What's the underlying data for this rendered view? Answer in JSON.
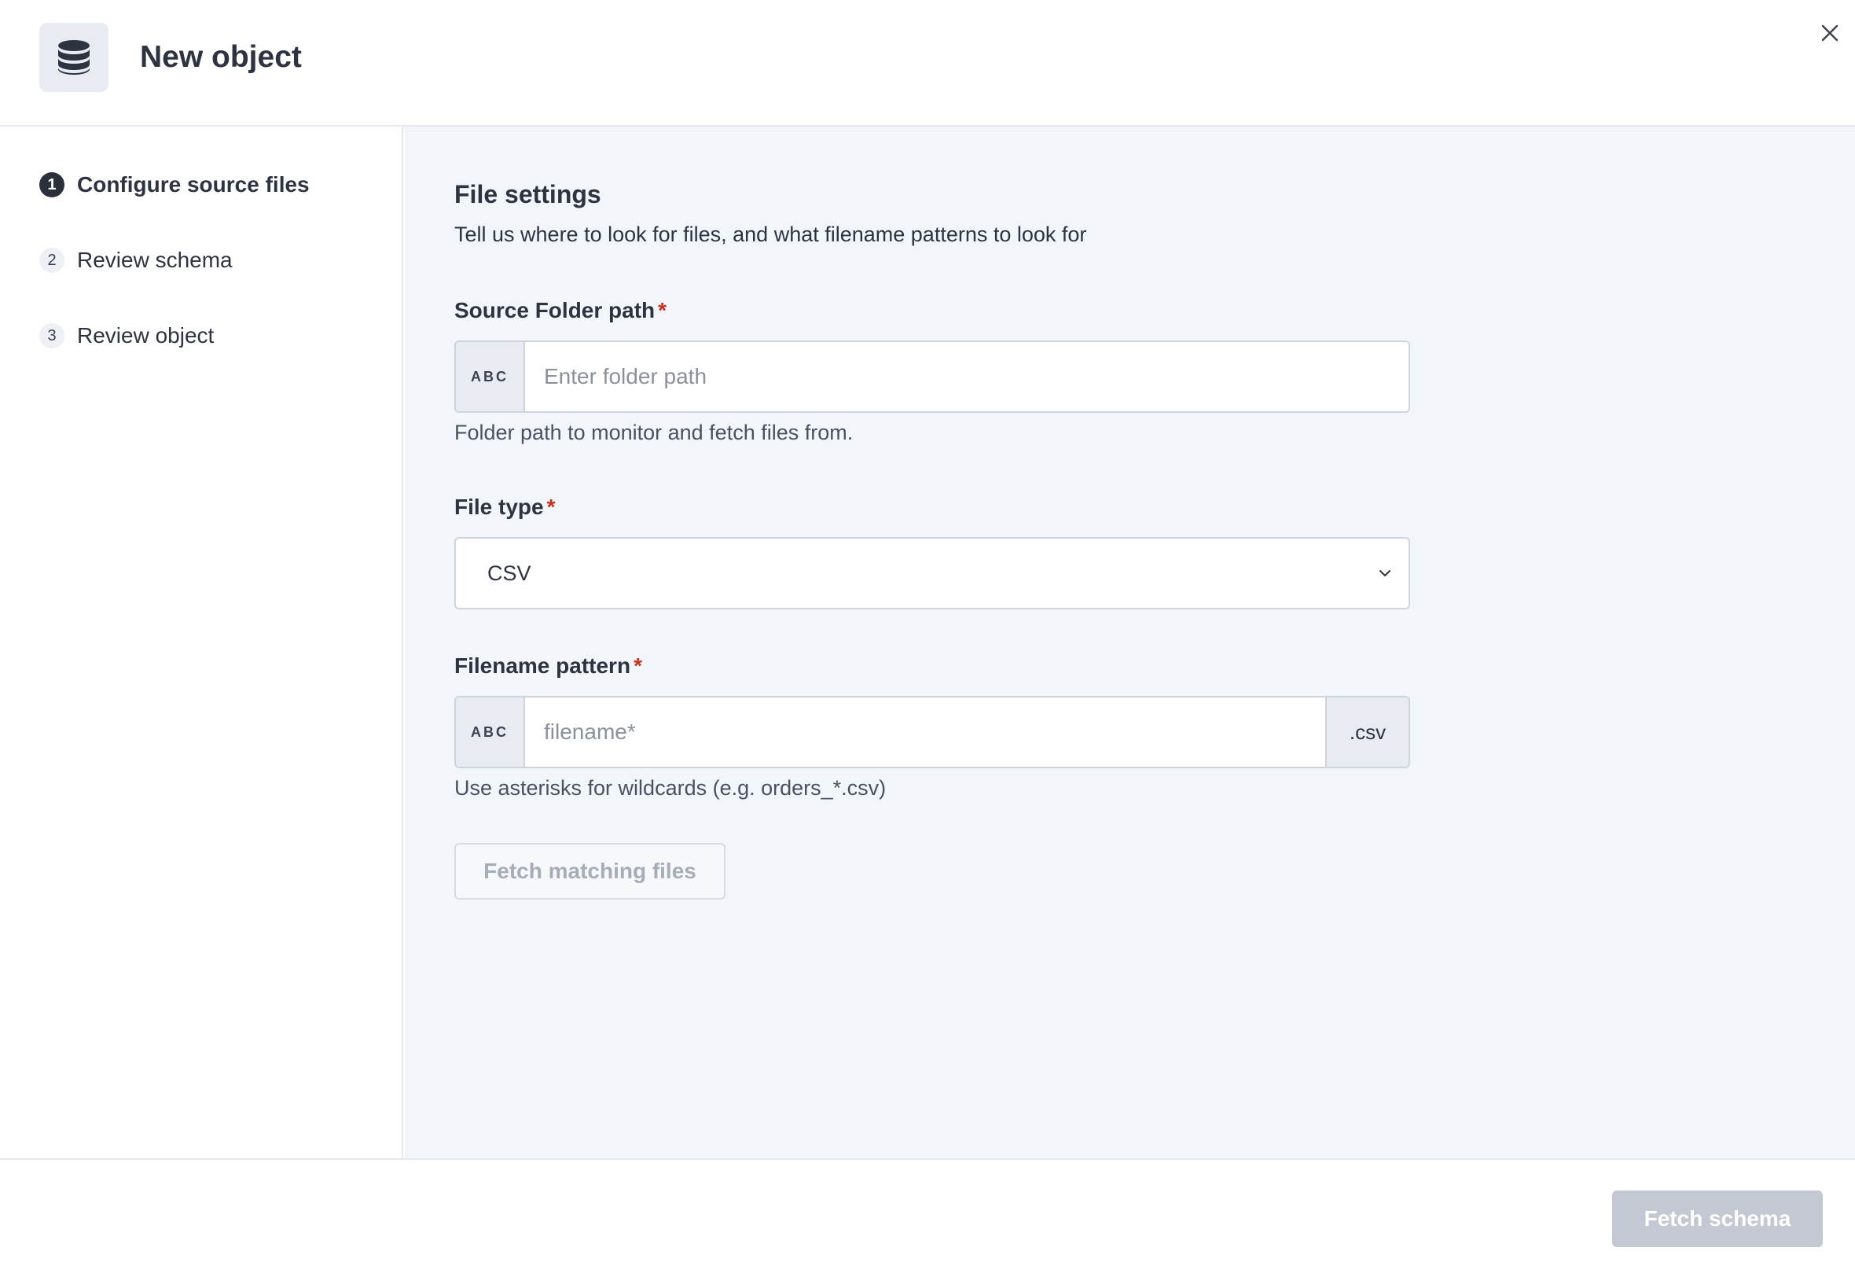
{
  "header": {
    "title": "New object",
    "icon": "database-icon",
    "close_icon": "close-icon"
  },
  "steps": [
    {
      "number": "1",
      "label": "Configure source files",
      "active": true
    },
    {
      "number": "2",
      "label": "Review schema",
      "active": false
    },
    {
      "number": "3",
      "label": "Review object",
      "active": false
    }
  ],
  "main": {
    "title": "File settings",
    "description": "Tell us where to look for files, and what filename patterns to look for",
    "source_folder": {
      "label": "Source Folder path",
      "required_mark": "*",
      "prefix": "ABC",
      "value": "",
      "placeholder": "Enter folder path",
      "help": "Folder path to monitor and fetch files from."
    },
    "file_type": {
      "label": "File type",
      "required_mark": "*",
      "selected": "CSV"
    },
    "filename_pattern": {
      "label": "Filename pattern",
      "required_mark": "*",
      "prefix": "ABC",
      "value": "",
      "placeholder": "filename*",
      "suffix": ".csv",
      "help": "Use asterisks for wildcards (e.g. orders_*.csv)"
    },
    "fetch_files_label": "Fetch matching files"
  },
  "footer": {
    "fetch_schema_label": "Fetch schema"
  },
  "colors": {
    "active_step": "#2b303b",
    "required": "#c8321e",
    "main_bg": "#f2f5f9",
    "disabled_primary": "#c3c8d2"
  }
}
